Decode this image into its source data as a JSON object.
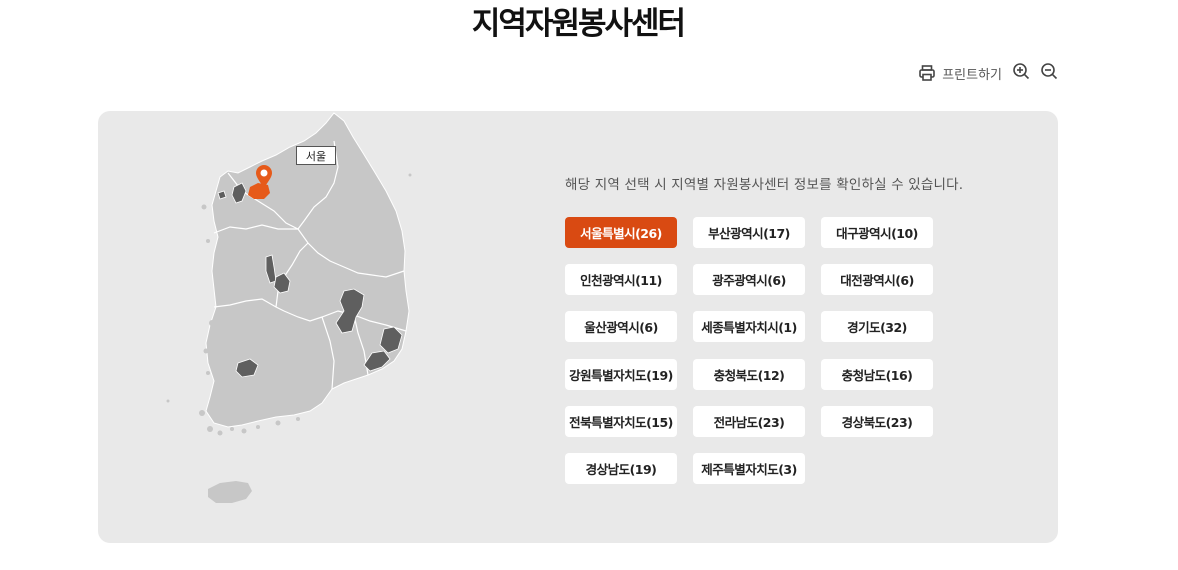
{
  "title": "지역자원봉사센터",
  "toolbar": {
    "print_label": "프린트하기",
    "print_icon": "printer-icon",
    "zoom_in_icon": "zoom-in-icon",
    "zoom_out_icon": "zoom-out-icon"
  },
  "map": {
    "selected_label": "서울",
    "accent_color": "#d94a12",
    "land_color": "#c7c7c7",
    "highlight_color": "#5f5f5f"
  },
  "info_text": "해당 지역 선택 시 지역별 자원봉사센터 정보를 확인하실 수 있습니다.",
  "regions": [
    {
      "label": "서울특별시(26)",
      "active": true
    },
    {
      "label": "부산광역시(17)"
    },
    {
      "label": "대구광역시(10)"
    },
    {
      "label": "인천광역시(11)"
    },
    {
      "label": "광주광역시(6)"
    },
    {
      "label": "대전광역시(6)"
    },
    {
      "label": "울산광역시(6)"
    },
    {
      "label": "세종특별자치시(1)"
    },
    {
      "label": "경기도(32)"
    },
    {
      "label": "강원특별자치도(19)"
    },
    {
      "label": "충청북도(12)"
    },
    {
      "label": "충청남도(16)"
    },
    {
      "label": "전북특별자치도(15)"
    },
    {
      "label": "전라남도(23)"
    },
    {
      "label": "경상북도(23)"
    },
    {
      "label": "경상남도(19)"
    },
    {
      "label": "제주특별자치도(3)"
    }
  ]
}
